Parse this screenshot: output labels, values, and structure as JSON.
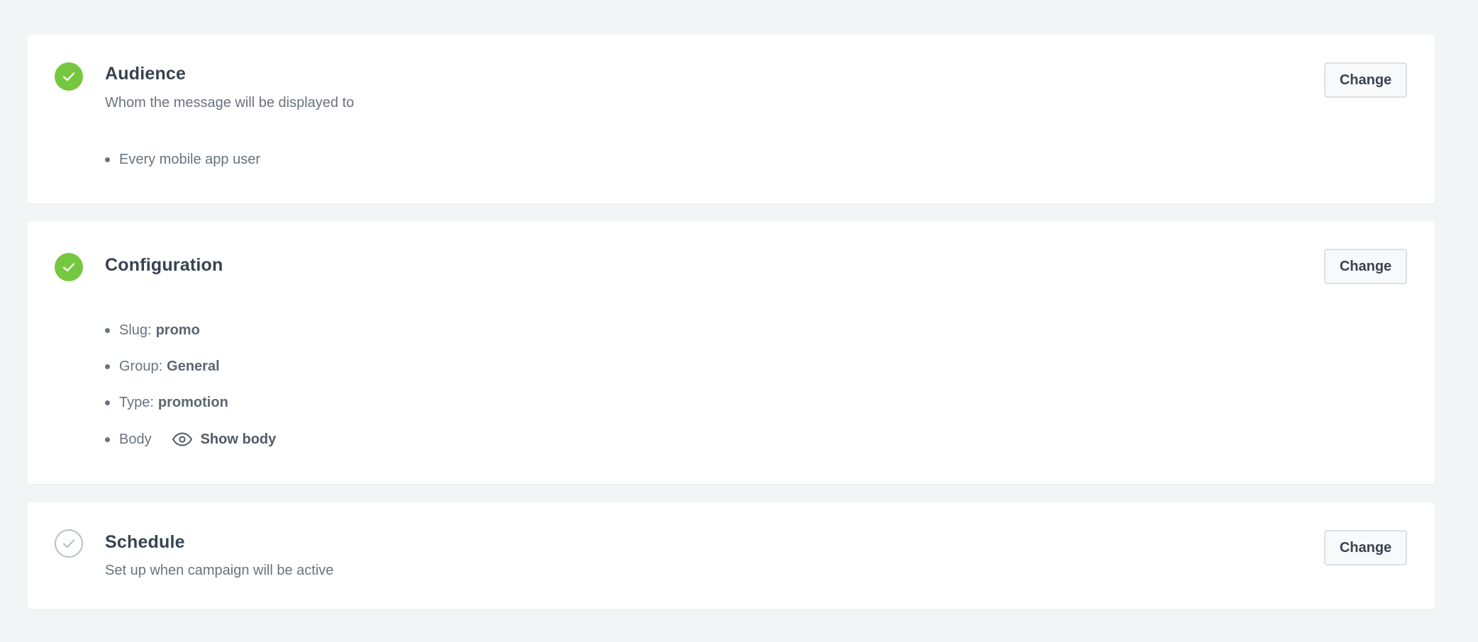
{
  "colors": {
    "page_bg": "#f3f4f6",
    "card_bg": "#ffffff",
    "done_green": "#76c740",
    "pending_gray": "#b9bec6",
    "title_text": "#384350",
    "muted_text": "#6a737d"
  },
  "sections": {
    "audience": {
      "status": "completed",
      "status_icon": "check-circle-filled-icon",
      "title": "Audience",
      "subtitle": "Whom the message will be displayed to",
      "change_label": "Change",
      "items": [
        {
          "text": "Every mobile app user"
        }
      ]
    },
    "configuration": {
      "status": "completed",
      "status_icon": "check-circle-filled-icon",
      "title": "Configuration",
      "change_label": "Change",
      "items": [
        {
          "label": "Slug:",
          "value": "promo"
        },
        {
          "label": "Group:",
          "value": "General"
        },
        {
          "label": "Type:",
          "value": "promotion"
        },
        {
          "label": "Body",
          "action_label": "Show body",
          "action_icon": "eye-icon"
        }
      ]
    },
    "schedule": {
      "status": "pending",
      "status_icon": "check-circle-outline-icon",
      "title": "Schedule",
      "subtitle": "Set up when campaign will be active",
      "change_label": "Change"
    }
  }
}
